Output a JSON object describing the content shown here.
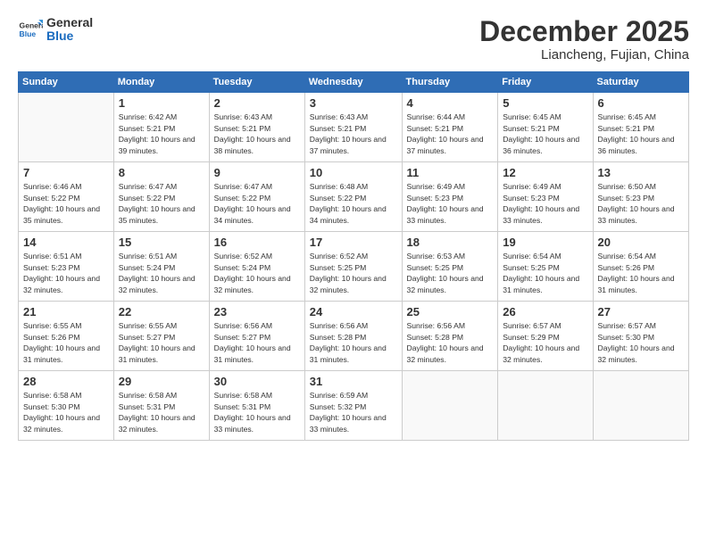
{
  "header": {
    "logo_line1": "General",
    "logo_line2": "Blue",
    "month": "December 2025",
    "location": "Liancheng, Fujian, China"
  },
  "days_of_week": [
    "Sunday",
    "Monday",
    "Tuesday",
    "Wednesday",
    "Thursday",
    "Friday",
    "Saturday"
  ],
  "weeks": [
    [
      {
        "day": "",
        "sunrise": "",
        "sunset": "",
        "daylight": ""
      },
      {
        "day": "1",
        "sunrise": "6:42 AM",
        "sunset": "5:21 PM",
        "daylight": "10 hours and 39 minutes."
      },
      {
        "day": "2",
        "sunrise": "6:43 AM",
        "sunset": "5:21 PM",
        "daylight": "10 hours and 38 minutes."
      },
      {
        "day": "3",
        "sunrise": "6:43 AM",
        "sunset": "5:21 PM",
        "daylight": "10 hours and 37 minutes."
      },
      {
        "day": "4",
        "sunrise": "6:44 AM",
        "sunset": "5:21 PM",
        "daylight": "10 hours and 37 minutes."
      },
      {
        "day": "5",
        "sunrise": "6:45 AM",
        "sunset": "5:21 PM",
        "daylight": "10 hours and 36 minutes."
      },
      {
        "day": "6",
        "sunrise": "6:45 AM",
        "sunset": "5:21 PM",
        "daylight": "10 hours and 36 minutes."
      }
    ],
    [
      {
        "day": "7",
        "sunrise": "6:46 AM",
        "sunset": "5:22 PM",
        "daylight": "10 hours and 35 minutes."
      },
      {
        "day": "8",
        "sunrise": "6:47 AM",
        "sunset": "5:22 PM",
        "daylight": "10 hours and 35 minutes."
      },
      {
        "day": "9",
        "sunrise": "6:47 AM",
        "sunset": "5:22 PM",
        "daylight": "10 hours and 34 minutes."
      },
      {
        "day": "10",
        "sunrise": "6:48 AM",
        "sunset": "5:22 PM",
        "daylight": "10 hours and 34 minutes."
      },
      {
        "day": "11",
        "sunrise": "6:49 AM",
        "sunset": "5:23 PM",
        "daylight": "10 hours and 33 minutes."
      },
      {
        "day": "12",
        "sunrise": "6:49 AM",
        "sunset": "5:23 PM",
        "daylight": "10 hours and 33 minutes."
      },
      {
        "day": "13",
        "sunrise": "6:50 AM",
        "sunset": "5:23 PM",
        "daylight": "10 hours and 33 minutes."
      }
    ],
    [
      {
        "day": "14",
        "sunrise": "6:51 AM",
        "sunset": "5:23 PM",
        "daylight": "10 hours and 32 minutes."
      },
      {
        "day": "15",
        "sunrise": "6:51 AM",
        "sunset": "5:24 PM",
        "daylight": "10 hours and 32 minutes."
      },
      {
        "day": "16",
        "sunrise": "6:52 AM",
        "sunset": "5:24 PM",
        "daylight": "10 hours and 32 minutes."
      },
      {
        "day": "17",
        "sunrise": "6:52 AM",
        "sunset": "5:25 PM",
        "daylight": "10 hours and 32 minutes."
      },
      {
        "day": "18",
        "sunrise": "6:53 AM",
        "sunset": "5:25 PM",
        "daylight": "10 hours and 32 minutes."
      },
      {
        "day": "19",
        "sunrise": "6:54 AM",
        "sunset": "5:25 PM",
        "daylight": "10 hours and 31 minutes."
      },
      {
        "day": "20",
        "sunrise": "6:54 AM",
        "sunset": "5:26 PM",
        "daylight": "10 hours and 31 minutes."
      }
    ],
    [
      {
        "day": "21",
        "sunrise": "6:55 AM",
        "sunset": "5:26 PM",
        "daylight": "10 hours and 31 minutes."
      },
      {
        "day": "22",
        "sunrise": "6:55 AM",
        "sunset": "5:27 PM",
        "daylight": "10 hours and 31 minutes."
      },
      {
        "day": "23",
        "sunrise": "6:56 AM",
        "sunset": "5:27 PM",
        "daylight": "10 hours and 31 minutes."
      },
      {
        "day": "24",
        "sunrise": "6:56 AM",
        "sunset": "5:28 PM",
        "daylight": "10 hours and 31 minutes."
      },
      {
        "day": "25",
        "sunrise": "6:56 AM",
        "sunset": "5:28 PM",
        "daylight": "10 hours and 32 minutes."
      },
      {
        "day": "26",
        "sunrise": "6:57 AM",
        "sunset": "5:29 PM",
        "daylight": "10 hours and 32 minutes."
      },
      {
        "day": "27",
        "sunrise": "6:57 AM",
        "sunset": "5:30 PM",
        "daylight": "10 hours and 32 minutes."
      }
    ],
    [
      {
        "day": "28",
        "sunrise": "6:58 AM",
        "sunset": "5:30 PM",
        "daylight": "10 hours and 32 minutes."
      },
      {
        "day": "29",
        "sunrise": "6:58 AM",
        "sunset": "5:31 PM",
        "daylight": "10 hours and 32 minutes."
      },
      {
        "day": "30",
        "sunrise": "6:58 AM",
        "sunset": "5:31 PM",
        "daylight": "10 hours and 33 minutes."
      },
      {
        "day": "31",
        "sunrise": "6:59 AM",
        "sunset": "5:32 PM",
        "daylight": "10 hours and 33 minutes."
      },
      {
        "day": "",
        "sunrise": "",
        "sunset": "",
        "daylight": ""
      },
      {
        "day": "",
        "sunrise": "",
        "sunset": "",
        "daylight": ""
      },
      {
        "day": "",
        "sunrise": "",
        "sunset": "",
        "daylight": ""
      }
    ]
  ]
}
